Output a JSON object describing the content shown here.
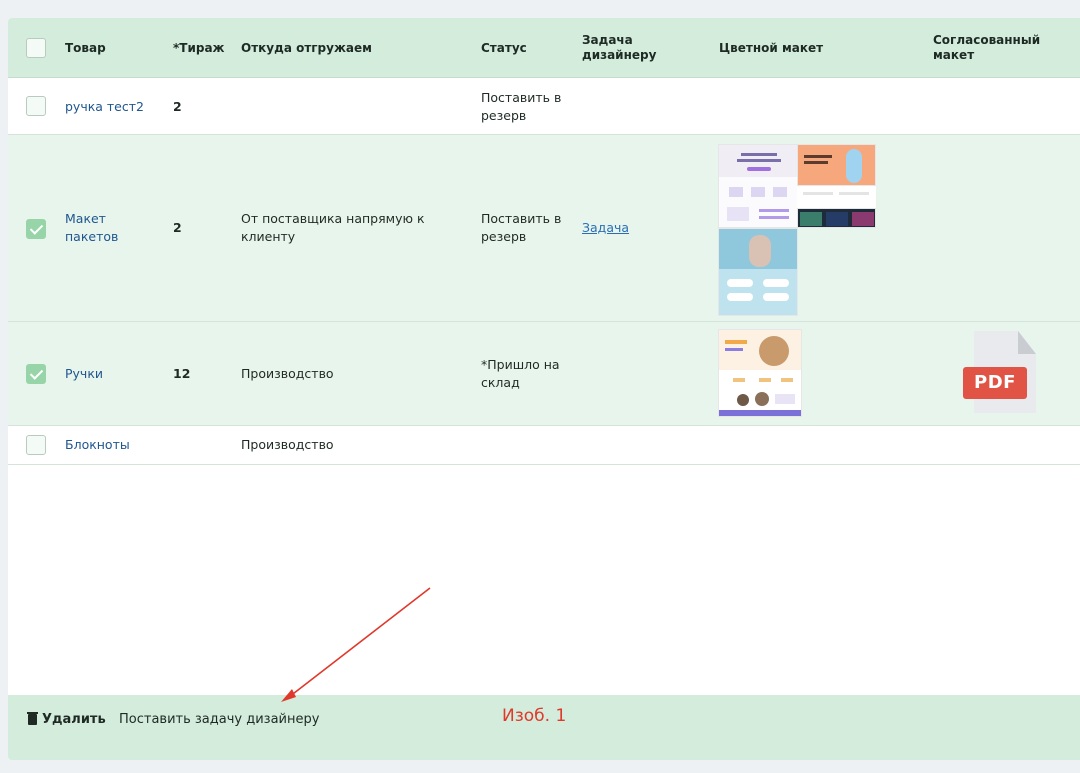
{
  "columns": [
    "Товар",
    "*Тираж",
    "Откуда отгружаем",
    "Статус",
    "Задача дизайнеру",
    "Цветной макет",
    "Согласованный макет"
  ],
  "rows": [
    {
      "product": "ручка тест2",
      "qty": "2",
      "source": "",
      "status": "Поставить в резерв",
      "task": "",
      "checked": false
    },
    {
      "product": "Макет пакетов",
      "qty": "2",
      "source": "От поставщика напрямую к клиенту",
      "status": "Поставить в резерв",
      "task": "Задача",
      "checked": true
    },
    {
      "product": "Ручки",
      "qty": "12",
      "source": "Производство",
      "status": "*Пришло на склад",
      "task": "",
      "checked": true
    },
    {
      "product": "Блокноты",
      "qty": "",
      "source": "Производство",
      "status": "",
      "task": "",
      "checked": false
    }
  ],
  "approved_file_label": "PDF",
  "footer": {
    "delete_label": "Удалить",
    "assign_label": "Поставить задачу дизайнеру"
  },
  "caption": "Изоб. 1",
  "colors": {
    "header_bg": "#d3ecdb",
    "row_checked_bg": "#e8f5ec",
    "link": "#20578f",
    "checkbox_checked": "#97d5a8",
    "pdf_red": "#e05345",
    "annotation_red": "#e0382b"
  },
  "icons": [
    "checkbox",
    "trash-icon",
    "pdf-file-icon",
    "annotation-arrow"
  ]
}
